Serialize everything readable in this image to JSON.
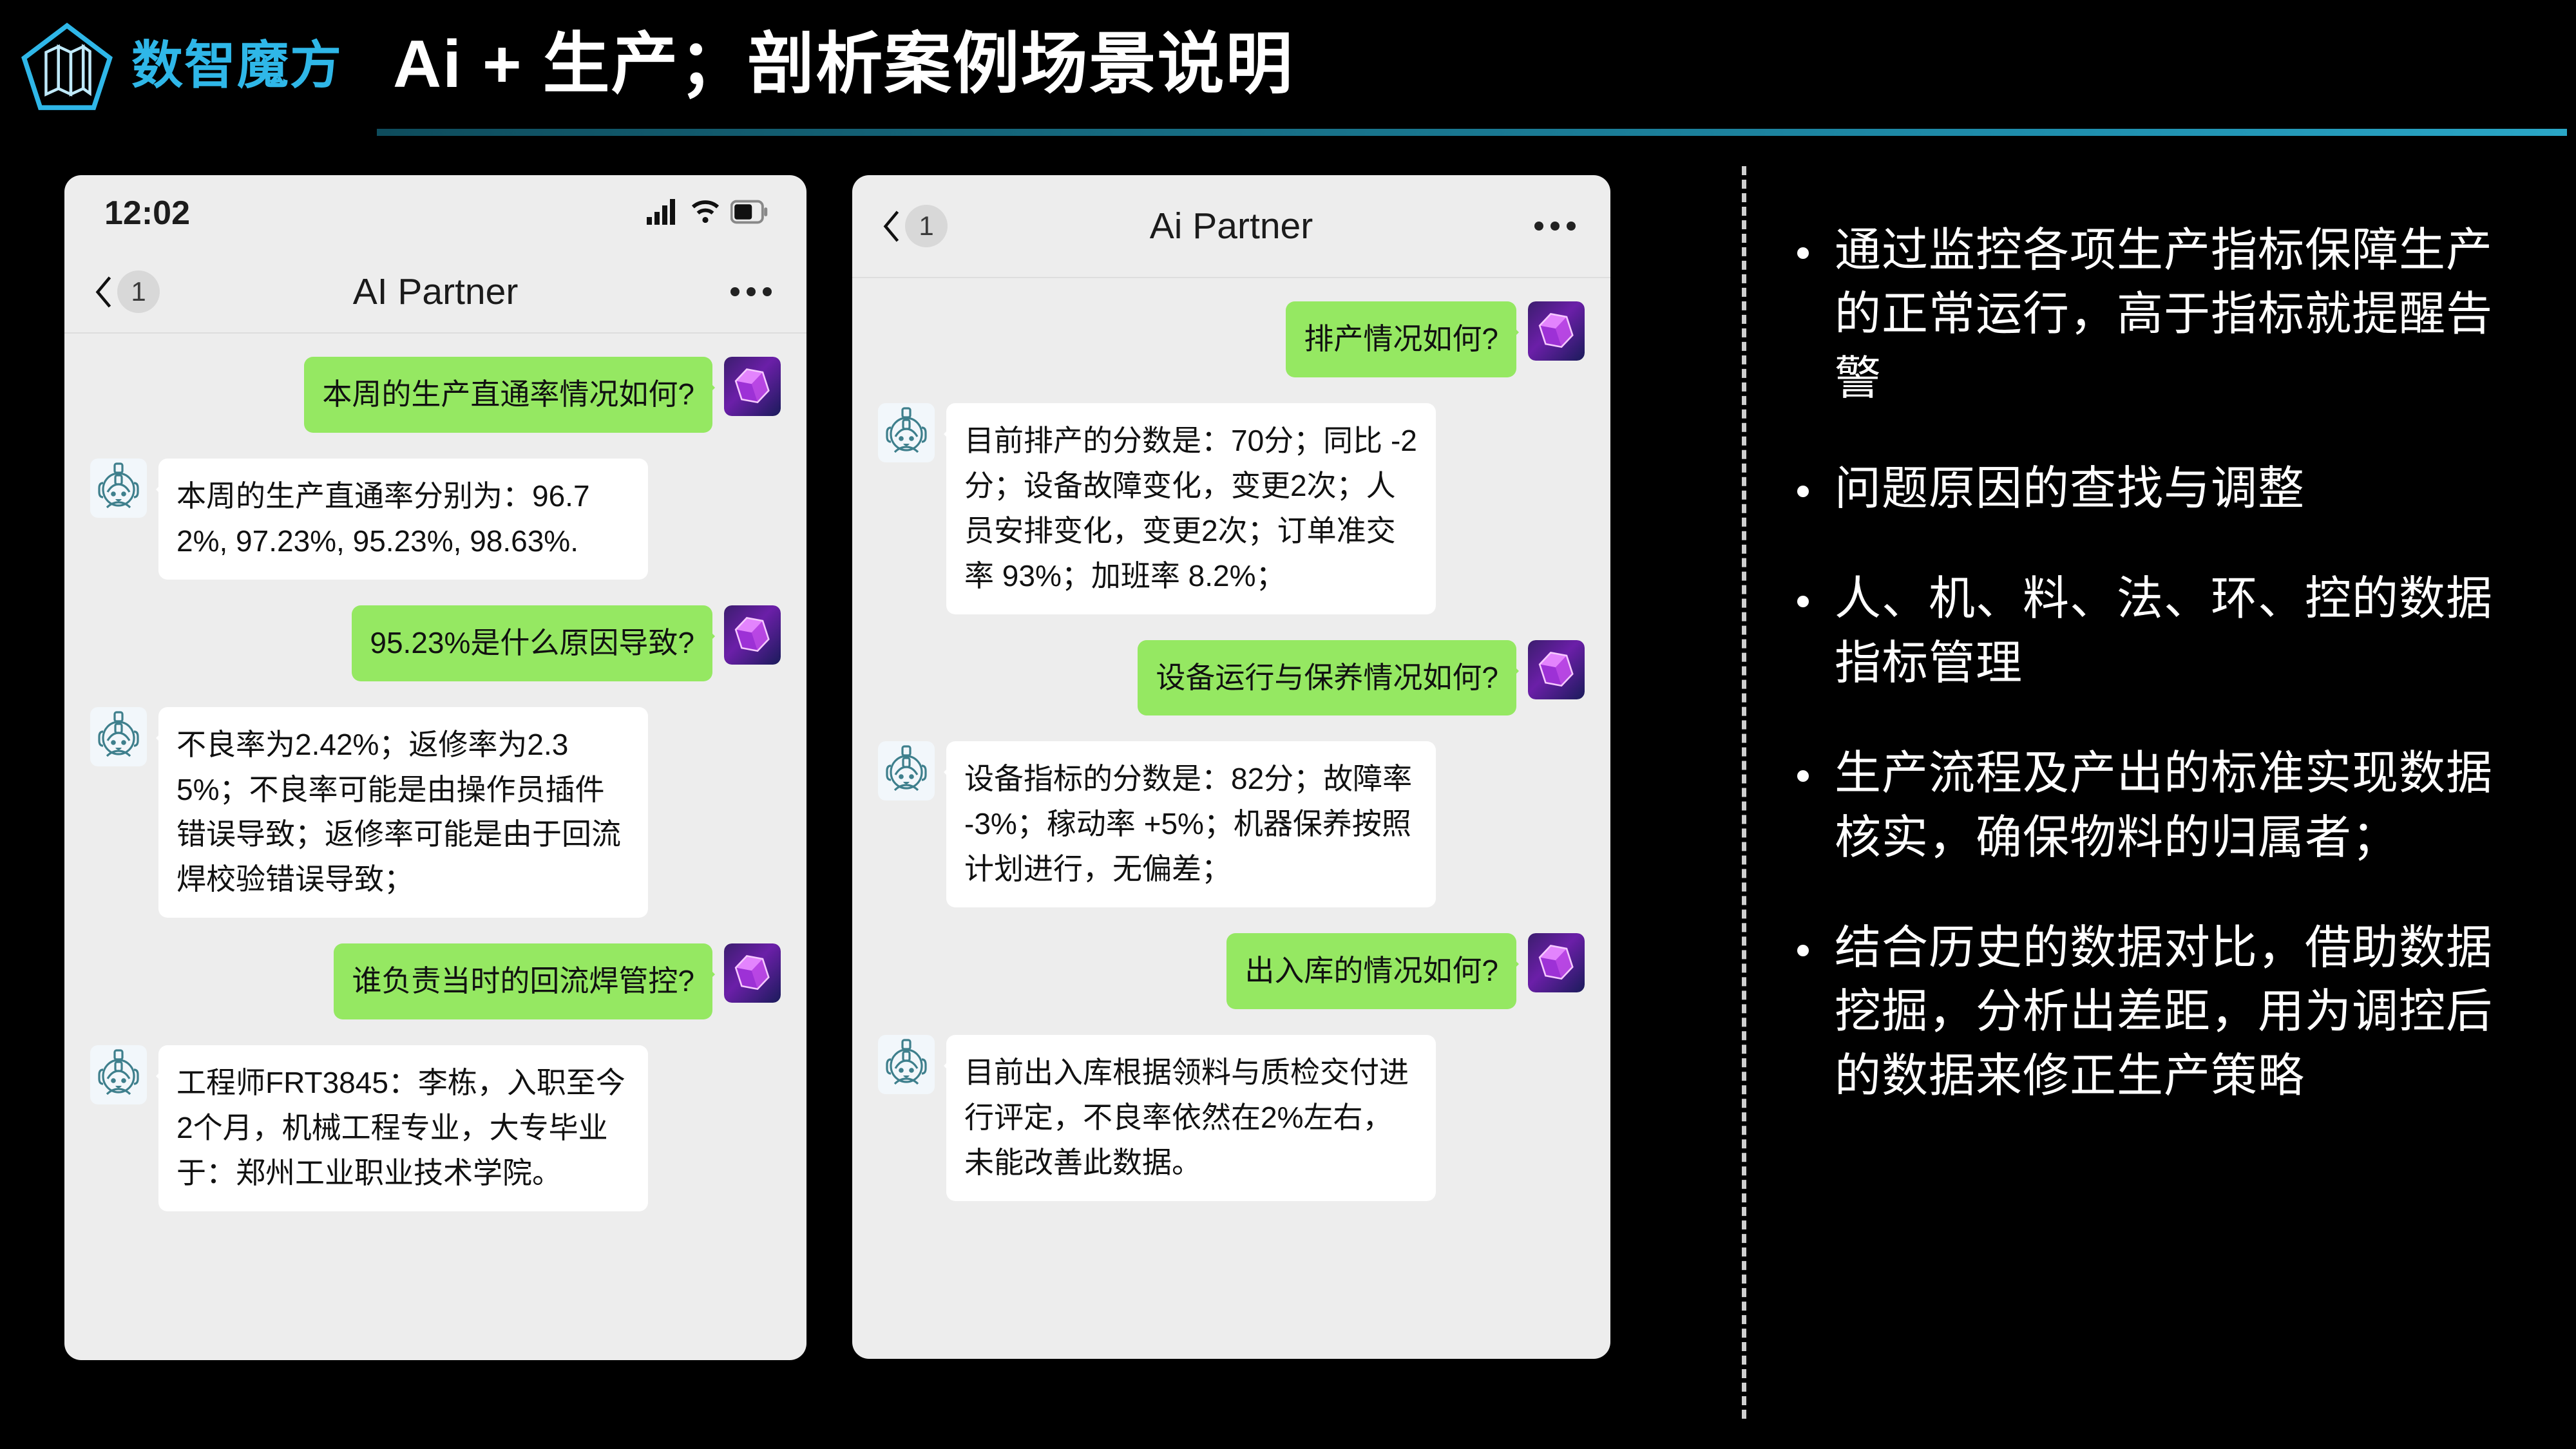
{
  "brand": {
    "logo_icon": "pentagon-map-logo-icon",
    "name": "数智魔方",
    "color": "#2fb7e8"
  },
  "header": {
    "title": "Ai + 生产；剖析案例场景说明",
    "rule_color": "#1f8fae"
  },
  "phones": [
    {
      "id": "left",
      "statusbar": {
        "time": "12:02",
        "signal_icon": "cellular-signal-icon",
        "wifi_icon": "wifi-icon",
        "battery_icon": "battery-icon"
      },
      "navbar": {
        "back_icon": "back-chevron-icon",
        "unread_count": "1",
        "title": "AI Partner",
        "more_icon": "more-dots-icon"
      },
      "messages": [
        {
          "side": "me",
          "text": "本周的生产直通率情况如何?",
          "short": true,
          "avatar": "purple-cube-avatar"
        },
        {
          "side": "bot",
          "text": "本周的生产直通率分别为：96.72%, 97.23%, 95.23%, 98.63%.",
          "short": false,
          "avatar": "robot-avatar"
        },
        {
          "side": "me",
          "text": "95.23%是什么原因导致?",
          "short": true,
          "avatar": "purple-cube-avatar"
        },
        {
          "side": "bot",
          "text": "不良率为2.42%；返修率为2.35%；不良率可能是由操作员插件错误导致；返修率可能是由于回流焊校验错误导致；",
          "short": false,
          "avatar": "robot-avatar"
        },
        {
          "side": "me",
          "text": "谁负责当时的回流焊管控?",
          "short": true,
          "avatar": "purple-cube-avatar"
        },
        {
          "side": "bot",
          "text": "工程师FRT3845：李栋，入职至今2个月，机械工程专业，大专毕业于：郑州工业职业技术学院。",
          "short": false,
          "avatar": "robot-avatar"
        }
      ]
    },
    {
      "id": "right",
      "navbar": {
        "back_icon": "back-chevron-icon",
        "unread_count": "1",
        "title": "Ai Partner",
        "more_icon": "more-dots-icon"
      },
      "messages": [
        {
          "side": "me",
          "text": "排产情况如何?",
          "short": true,
          "avatar": "purple-cube-avatar"
        },
        {
          "side": "bot",
          "text": "目前排产的分数是：70分；同比 -2分；设备故障变化，变更2次；人员安排变化，变更2次；订单准交率 93%；加班率 8.2%；",
          "short": false,
          "avatar": "robot-avatar"
        },
        {
          "side": "me",
          "text": "设备运行与保养情况如何?",
          "short": true,
          "avatar": "purple-cube-avatar"
        },
        {
          "side": "bot",
          "text": "设备指标的分数是：82分；故障率 -3%；稼动率 +5%；机器保养按照计划进行，无偏差；",
          "short": false,
          "avatar": "robot-avatar"
        },
        {
          "side": "me",
          "text": "出入库的情况如何?",
          "short": true,
          "avatar": "purple-cube-avatar"
        },
        {
          "side": "bot",
          "text": "目前出入库根据领料与质检交付进行评定，不良率依然在2%左右，未能改善此数据。",
          "short": false,
          "avatar": "robot-avatar"
        }
      ]
    }
  ],
  "bullets": [
    "通过监控各项生产指标保障生产的正常运行，高于指标就提醒告警",
    "问题原因的查找与调整",
    "人、机、料、法、环、控的数据指标管理",
    "生产流程及产出的标准实现数据核实，确保物料的归属者；",
    "结合历史的数据对比，借助数据挖掘，分析出差距，用为调控后的数据来修正生产策略"
  ]
}
